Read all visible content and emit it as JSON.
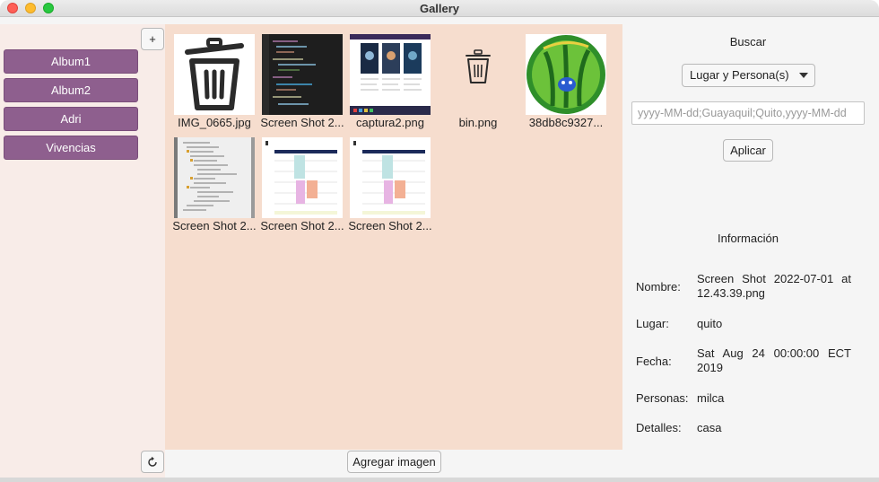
{
  "window": {
    "title": "Gallery"
  },
  "sidebar": {
    "add_label": "+",
    "refresh_icon": "refresh-icon",
    "albums": [
      {
        "label": "Album1"
      },
      {
        "label": "Album2"
      },
      {
        "label": "Adri"
      },
      {
        "label": "Vivencias"
      }
    ]
  },
  "gallery": {
    "images": [
      {
        "caption": "IMG_0665.jpg",
        "icon": "trash-bin-large-icon"
      },
      {
        "caption": "Screen Shot 2...",
        "icon": "code-screenshot-thumbnail"
      },
      {
        "caption": "captura2.png",
        "icon": "webpage-screenshot-thumbnail"
      },
      {
        "caption": "bin.png",
        "icon": "trash-bin-small-icon"
      },
      {
        "caption": "38db8c9327...",
        "icon": "green-circle-logo-thumbnail"
      },
      {
        "caption": "Screen Shot 2...",
        "icon": "file-tree-screenshot-thumbnail"
      },
      {
        "caption": "Screen Shot 2...",
        "icon": "schedule-table-thumbnail"
      },
      {
        "caption": "Screen Shot 2...",
        "icon": "schedule-table-thumbnail"
      }
    ],
    "add_image_label": "Agregar imagen"
  },
  "search": {
    "heading": "Buscar",
    "filter_selected": "Lugar y Persona(s)",
    "placeholder": "yyyy-MM-dd;Guayaquil;Quito,yyyy-MM-dd",
    "apply_label": "Aplicar"
  },
  "info": {
    "heading": "Información",
    "fields": [
      {
        "key": "Nombre:",
        "value": "Screen Shot 2022-07-01 at 12.43.39.png"
      },
      {
        "key": "Lugar:",
        "value": "quito"
      },
      {
        "key": "Fecha:",
        "value": "Sat Aug 24 00:00:00 ECT 2019"
      },
      {
        "key": "Personas:",
        "value": "milca"
      },
      {
        "key": "Detalles:",
        "value": "casa"
      }
    ]
  }
}
